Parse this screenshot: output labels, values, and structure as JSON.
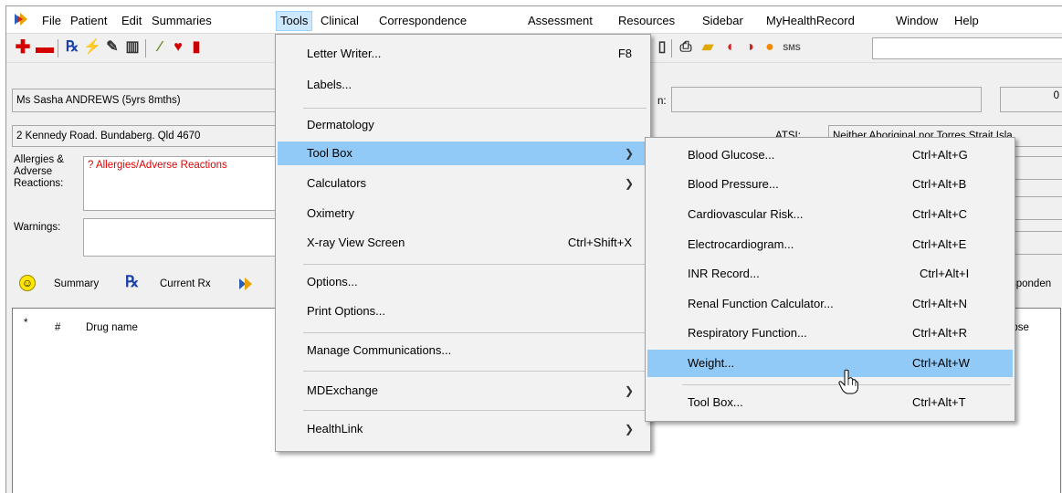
{
  "menubar": {
    "items": [
      "File",
      "Patient",
      "Edit",
      "Summaries",
      "Tools",
      "Clinical",
      "Correspondence",
      "Assessment",
      "Resources",
      "Sidebar",
      "MyHealthRecord",
      "Window",
      "Help"
    ]
  },
  "patient": {
    "name": "Ms Sasha ANDREWS (5yrs 8mths)",
    "address": "2 Kennedy Road. Bundaberg. Qld  4670",
    "allergies_label": "Allergies &\nAdverse\nReactions:",
    "allergies_value": "? Allergies/Adverse Reactions",
    "warnings_label": "Warnings:",
    "right_label_partial": "n:",
    "right_value_partial": "0",
    "atsi_label": "ATSI:",
    "atsi_value_partial": "Neither Aboriginal nor Torres Strait Isla"
  },
  "tabs": {
    "summary": "Summary",
    "current_rx": "Current Rx",
    "correspondence_partial": "sponden"
  },
  "grid": {
    "columns": [
      "*",
      "#",
      "Drug name"
    ],
    "right_col_partial": "apse"
  },
  "tools_menu": {
    "items": [
      {
        "label": "Letter Writer...",
        "shortcut": "F8"
      },
      {
        "label": "Labels...",
        "shortcut": ""
      },
      {
        "label": "Dermatology",
        "shortcut": ""
      },
      {
        "label": "Tool Box",
        "shortcut": "",
        "submenu": true
      },
      {
        "label": "Calculators",
        "shortcut": "",
        "submenu": true
      },
      {
        "label": "Oximetry",
        "shortcut": ""
      },
      {
        "label": "X-ray View Screen",
        "shortcut": "Ctrl+Shift+X"
      },
      {
        "label": "Options...",
        "shortcut": ""
      },
      {
        "label": "Print Options...",
        "shortcut": ""
      },
      {
        "label": "Manage Communications...",
        "shortcut": ""
      },
      {
        "label": "MDExchange",
        "shortcut": "",
        "submenu": true
      },
      {
        "label": "HealthLink",
        "shortcut": "",
        "submenu": true
      }
    ]
  },
  "toolbox_menu": {
    "items": [
      {
        "label": "Blood Glucose...",
        "shortcut": "Ctrl+Alt+G"
      },
      {
        "label": "Blood Pressure...",
        "shortcut": "Ctrl+Alt+B"
      },
      {
        "label": "Cardiovascular Risk...",
        "shortcut": "Ctrl+Alt+C"
      },
      {
        "label": "Electrocardiogram...",
        "shortcut": "Ctrl+Alt+E"
      },
      {
        "label": "INR Record...",
        "shortcut": "Ctrl+Alt+I"
      },
      {
        "label": "Renal Function Calculator...",
        "shortcut": "Ctrl+Alt+N"
      },
      {
        "label": "Respiratory Function...",
        "shortcut": "Ctrl+Alt+R"
      },
      {
        "label": "Weight...",
        "shortcut": "Ctrl+Alt+W"
      },
      {
        "label": "Tool Box...",
        "shortcut": "Ctrl+Alt+T"
      }
    ]
  },
  "colors": {
    "highlight": "#91c9f7",
    "active_menu": "#cce8ff",
    "allergy_text": "#e00000"
  }
}
